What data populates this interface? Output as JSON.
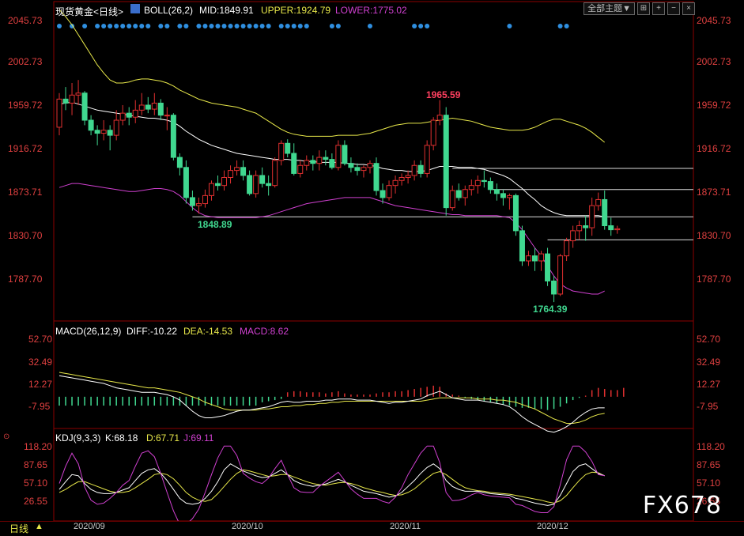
{
  "header": {
    "instrument": "现货黄金<日线>",
    "boll_label": "BOLL(26,2)",
    "mid": "MID:1849.91",
    "upper": "UPPER:1924.79",
    "lower": "LOWER:1775.02",
    "theme_button": "全部主题▼"
  },
  "macd_header": {
    "label": "MACD(26,12,9)",
    "diff": "DIFF:-10.22",
    "dea": "DEA:-14.53",
    "macd": "MACD:8.62"
  },
  "kdj_header": {
    "label": "KDJ(9,3,3)",
    "k": "K:68.18",
    "d": "D:67.71",
    "j": "J:69.11"
  },
  "timeframe": "日线",
  "watermark": "FX678",
  "dates": [
    "2020/09",
    "2020/10",
    "2020/11",
    "2020/12"
  ],
  "price_ticks": [
    "2045.73",
    "2002.73",
    "1959.72",
    "1916.72",
    "1873.71",
    "1830.70",
    "1787.70"
  ],
  "macd_ticks": [
    "52.70",
    "32.49",
    "12.27",
    "-7.95"
  ],
  "kdj_ticks": [
    "118.20",
    "87.65",
    "57.10",
    "26.55"
  ],
  "annotations": {
    "high": "1965.59",
    "low": "1764.39",
    "mark": "1848.89"
  },
  "colors": {
    "up": "#e03030",
    "down": "#40d890",
    "mid": "#ffffff",
    "upper": "#e8e84a",
    "lower": "#d040d0",
    "axis": "#e04040",
    "grid": "#8b0000"
  },
  "chart_data": {
    "type": "candlestick",
    "ylim": [
      1760,
      2050
    ],
    "candles": [
      [
        1938,
        1972,
        1930,
        1966
      ],
      [
        1966,
        1978,
        1955,
        1962
      ],
      [
        1962,
        1982,
        1950,
        1970
      ],
      [
        1970,
        1985,
        1960,
        1972
      ],
      [
        1972,
        1974,
        1940,
        1945
      ],
      [
        1945,
        1950,
        1930,
        1935
      ],
      [
        1935,
        1940,
        1920,
        1932
      ],
      [
        1932,
        1945,
        1925,
        1935
      ],
      [
        1935,
        1940,
        1915,
        1930
      ],
      [
        1930,
        1955,
        1925,
        1945
      ],
      [
        1945,
        1960,
        1940,
        1952
      ],
      [
        1952,
        1958,
        1940,
        1948
      ],
      [
        1948,
        1965,
        1942,
        1955
      ],
      [
        1955,
        1972,
        1950,
        1960
      ],
      [
        1960,
        1968,
        1952,
        1956
      ],
      [
        1956,
        1972,
        1950,
        1962
      ],
      [
        1962,
        1966,
        1945,
        1950
      ],
      [
        1950,
        1958,
        1935,
        1950
      ],
      [
        1950,
        1952,
        1905,
        1908
      ],
      [
        1908,
        1912,
        1890,
        1898
      ],
      [
        1898,
        1905,
        1862,
        1868
      ],
      [
        1868,
        1875,
        1855,
        1860
      ],
      [
        1860,
        1868,
        1852,
        1862
      ],
      [
        1862,
        1876,
        1858,
        1870
      ],
      [
        1870,
        1885,
        1865,
        1882
      ],
      [
        1882,
        1890,
        1875,
        1880
      ],
      [
        1880,
        1895,
        1875,
        1888
      ],
      [
        1888,
        1900,
        1882,
        1895
      ],
      [
        1895,
        1905,
        1890,
        1898
      ],
      [
        1898,
        1905,
        1885,
        1890
      ],
      [
        1890,
        1895,
        1870,
        1872
      ],
      [
        1872,
        1895,
        1868,
        1890
      ],
      [
        1890,
        1898,
        1878,
        1882
      ],
      [
        1882,
        1890,
        1870,
        1880
      ],
      [
        1880,
        1908,
        1878,
        1905
      ],
      [
        1905,
        1925,
        1900,
        1922
      ],
      [
        1922,
        1926,
        1908,
        1912
      ],
      [
        1912,
        1922,
        1890,
        1892
      ],
      [
        1892,
        1905,
        1888,
        1900
      ],
      [
        1900,
        1910,
        1895,
        1905
      ],
      [
        1905,
        1910,
        1895,
        1902
      ],
      [
        1902,
        1915,
        1895,
        1908
      ],
      [
        1908,
        1915,
        1900,
        1906
      ],
      [
        1906,
        1912,
        1896,
        1898
      ],
      [
        1898,
        1925,
        1895,
        1920
      ],
      [
        1920,
        1925,
        1900,
        1902
      ],
      [
        1902,
        1908,
        1893,
        1898
      ],
      [
        1898,
        1902,
        1890,
        1895
      ],
      [
        1895,
        1900,
        1888,
        1898
      ],
      [
        1898,
        1905,
        1892,
        1902
      ],
      [
        1902,
        1908,
        1870,
        1875
      ],
      [
        1875,
        1882,
        1862,
        1868
      ],
      [
        1868,
        1885,
        1865,
        1880
      ],
      [
        1880,
        1890,
        1872,
        1885
      ],
      [
        1885,
        1892,
        1880,
        1888
      ],
      [
        1888,
        1895,
        1882,
        1890
      ],
      [
        1890,
        1905,
        1885,
        1900
      ],
      [
        1900,
        1905,
        1888,
        1892
      ],
      [
        1892,
        1925,
        1888,
        1920
      ],
      [
        1920,
        1948,
        1915,
        1945
      ],
      [
        1945,
        1965,
        1940,
        1950
      ],
      [
        1950,
        1958,
        1850,
        1858
      ],
      [
        1858,
        1880,
        1855,
        1875
      ],
      [
        1875,
        1882,
        1865,
        1868
      ],
      [
        1868,
        1880,
        1860,
        1876
      ],
      [
        1876,
        1886,
        1870,
        1880
      ],
      [
        1880,
        1890,
        1872,
        1885
      ],
      [
        1885,
        1895,
        1878,
        1884
      ],
      [
        1884,
        1888,
        1872,
        1876
      ],
      [
        1876,
        1882,
        1865,
        1872
      ],
      [
        1872,
        1876,
        1860,
        1868
      ],
      [
        1868,
        1872,
        1856,
        1870
      ],
      [
        1870,
        1872,
        1830,
        1835
      ],
      [
        1835,
        1840,
        1800,
        1805
      ],
      [
        1805,
        1815,
        1800,
        1810
      ],
      [
        1810,
        1818,
        1795,
        1805
      ],
      [
        1805,
        1815,
        1795,
        1812
      ],
      [
        1812,
        1818,
        1780,
        1785
      ],
      [
        1785,
        1790,
        1764,
        1772
      ],
      [
        1772,
        1812,
        1770,
        1810
      ],
      [
        1810,
        1828,
        1805,
        1825
      ],
      [
        1825,
        1840,
        1818,
        1835
      ],
      [
        1835,
        1845,
        1826,
        1840
      ],
      [
        1840,
        1850,
        1825,
        1838
      ],
      [
        1838,
        1868,
        1830,
        1860
      ],
      [
        1860,
        1873,
        1855,
        1866
      ],
      [
        1866,
        1875,
        1836,
        1840
      ],
      [
        1840,
        1848,
        1830,
        1836
      ],
      [
        1836,
        1840,
        1832,
        1837
      ]
    ],
    "mid_line": [
      1961,
      1962,
      1963,
      1961,
      1959,
      1957,
      1955,
      1954,
      1953,
      1952,
      1951,
      1950,
      1949,
      1948,
      1947,
      1947,
      1946,
      1945,
      1943,
      1939,
      1934,
      1930,
      1926,
      1923,
      1920,
      1918,
      1916,
      1914,
      1912,
      1911,
      1910,
      1909,
      1908,
      1907,
      1906,
      1906,
      1906,
      1905,
      1905,
      1904,
      1904,
      1903,
      1903,
      1903,
      1903,
      1902,
      1902,
      1901,
      1901,
      1900,
      1899,
      1897,
      1896,
      1895,
      1895,
      1894,
      1894,
      1894,
      1895,
      1897,
      1899,
      1899,
      1899,
      1898,
      1898,
      1898,
      1897,
      1896,
      1894,
      1892,
      1890,
      1887,
      1882,
      1877,
      1871,
      1866,
      1860,
      1856,
      1853,
      1851,
      1850,
      1850,
      1850,
      1850,
      1850,
      1850,
      1849
    ],
    "upper_line": [
      2055,
      2048,
      2040,
      2030,
      2020,
      2010,
      2000,
      1992,
      1985,
      1982,
      1982,
      1983,
      1985,
      1986,
      1986,
      1985,
      1984,
      1982,
      1979,
      1975,
      1972,
      1969,
      1966,
      1964,
      1962,
      1961,
      1960,
      1959,
      1958,
      1956,
      1954,
      1952,
      1948,
      1944,
      1940,
      1936,
      1933,
      1931,
      1930,
      1929,
      1929,
      1929,
      1929,
      1929,
      1930,
      1930,
      1930,
      1930,
      1931,
      1932,
      1934,
      1936,
      1938,
      1940,
      1941,
      1942,
      1942,
      1942,
      1943,
      1944,
      1945,
      1946,
      1947,
      1946,
      1945,
      1944,
      1942,
      1940,
      1938,
      1937,
      1936,
      1935,
      1935,
      1935,
      1936,
      1938,
      1941,
      1944,
      1946,
      1946,
      1944,
      1942,
      1940,
      1937,
      1933,
      1928,
      1923
    ],
    "lower_line": [
      1878,
      1880,
      1882,
      1882,
      1881,
      1880,
      1879,
      1878,
      1877,
      1876,
      1875,
      1874,
      1874,
      1875,
      1876,
      1877,
      1877,
      1876,
      1874,
      1870,
      1864,
      1858,
      1853,
      1850,
      1849,
      1848,
      1848,
      1848,
      1848,
      1848,
      1848,
      1848,
      1849,
      1850,
      1852,
      1854,
      1856,
      1858,
      1860,
      1862,
      1863,
      1864,
      1865,
      1866,
      1867,
      1868,
      1868,
      1868,
      1868,
      1868,
      1866,
      1864,
      1862,
      1860,
      1859,
      1858,
      1857,
      1856,
      1855,
      1854,
      1853,
      1852,
      1851,
      1851,
      1850,
      1850,
      1850,
      1850,
      1850,
      1850,
      1849,
      1848,
      1843,
      1836,
      1827,
      1818,
      1810,
      1800,
      1790,
      1782,
      1778,
      1775,
      1774,
      1773,
      1772,
      1772,
      1775
    ],
    "macd_hist": [
      -8,
      -8,
      -8,
      -8,
      -8,
      -8,
      -8,
      -8,
      -8,
      -8,
      -8,
      -8,
      -8,
      -8,
      -8,
      -8,
      -8,
      -8,
      -8,
      -8,
      -8,
      -8,
      -8,
      -8,
      -8,
      -8,
      -8,
      -8,
      -8,
      -8,
      -8,
      -8,
      -5,
      -4,
      -3,
      -2,
      4,
      5,
      5,
      4,
      4,
      4,
      3,
      4,
      5,
      3,
      2,
      2,
      2,
      2,
      3,
      4,
      4,
      5,
      5,
      6,
      7,
      8,
      9,
      10,
      9,
      3,
      2,
      1,
      -1,
      -2,
      -3,
      -4,
      -5,
      -6,
      -7,
      -8,
      -9,
      -10,
      -10,
      -11,
      -11,
      -12,
      -11,
      -9,
      -6,
      -3,
      -1,
      1,
      6,
      8,
      7,
      6,
      6,
      8
    ],
    "macd_diff": [
      19,
      18,
      17,
      16,
      15,
      14,
      13,
      12,
      10,
      8,
      7,
      6,
      5,
      4,
      4,
      4,
      3,
      2,
      0,
      -3,
      -8,
      -13,
      -17,
      -19,
      -19,
      -18,
      -17,
      -15,
      -13,
      -12,
      -12,
      -11,
      -10,
      -9,
      -7,
      -5,
      -4,
      -5,
      -5,
      -4,
      -4,
      -4,
      -3,
      -3,
      -2,
      -2,
      -2,
      -3,
      -3,
      -3,
      -4,
      -5,
      -6,
      -5,
      -5,
      -4,
      -3,
      -2,
      1,
      3,
      5,
      2,
      -1,
      -2,
      -3,
      -3,
      -3,
      -4,
      -5,
      -6,
      -7,
      -9,
      -13,
      -18,
      -22,
      -25,
      -28,
      -31,
      -32,
      -30,
      -27,
      -23,
      -18,
      -14,
      -11,
      -10,
      -10
    ],
    "macd_dea": [
      22,
      21,
      20,
      19,
      18,
      17,
      16,
      15,
      14,
      13,
      12,
      11,
      10,
      9,
      8,
      8,
      7,
      6,
      5,
      4,
      2,
      0,
      -2,
      -5,
      -7,
      -9,
      -11,
      -12,
      -12,
      -12,
      -12,
      -12,
      -11,
      -11,
      -10,
      -9,
      -9,
      -8,
      -8,
      -7,
      -7,
      -6,
      -6,
      -5,
      -5,
      -4,
      -4,
      -4,
      -4,
      -4,
      -4,
      -4,
      -4,
      -4,
      -4,
      -4,
      -4,
      -4,
      -3,
      -2,
      -1,
      -1,
      -1,
      -1,
      -1,
      -1,
      -2,
      -2,
      -2,
      -3,
      -3,
      -4,
      -5,
      -7,
      -9,
      -11,
      -14,
      -17,
      -20,
      -22,
      -24,
      -24,
      -23,
      -21,
      -18,
      -16,
      -15
    ],
    "kdj_k": [
      45,
      58,
      70,
      68,
      55,
      45,
      40,
      38,
      38,
      40,
      44,
      48,
      60,
      72,
      78,
      80,
      72,
      60,
      45,
      30,
      22,
      20,
      22,
      30,
      42,
      58,
      78,
      88,
      82,
      76,
      72,
      68,
      65,
      66,
      72,
      78,
      70,
      60,
      55,
      52,
      50,
      52,
      54,
      58,
      62,
      58,
      52,
      47,
      42,
      40,
      38,
      35,
      32,
      34,
      40,
      50,
      60,
      72,
      82,
      88,
      80,
      60,
      50,
      45,
      42,
      42,
      42,
      40,
      38,
      37,
      36,
      35,
      30,
      28,
      25,
      22,
      20,
      18,
      20,
      35,
      55,
      75,
      85,
      88,
      80,
      72,
      68
    ],
    "kdj_d": [
      40,
      45,
      52,
      58,
      58,
      54,
      50,
      46,
      42,
      40,
      40,
      42,
      48,
      55,
      62,
      70,
      72,
      70,
      63,
      52,
      40,
      32,
      27,
      25,
      28,
      38,
      50,
      62,
      72,
      78,
      76,
      73,
      70,
      67,
      68,
      70,
      70,
      66,
      62,
      58,
      55,
      53,
      52,
      54,
      56,
      57,
      55,
      52,
      48,
      45,
      42,
      40,
      37,
      35,
      36,
      40,
      46,
      55,
      64,
      72,
      75,
      70,
      62,
      54,
      48,
      45,
      43,
      42,
      40,
      39,
      38,
      37,
      35,
      33,
      31,
      29,
      27,
      24,
      22,
      26,
      35,
      48,
      60,
      70,
      74,
      73,
      68
    ],
    "kdj_j": [
      55,
      84,
      106,
      88,
      49,
      27,
      20,
      22,
      30,
      40,
      52,
      60,
      84,
      106,
      110,
      100,
      72,
      40,
      9,
      -14,
      -14,
      -4,
      12,
      40,
      70,
      98,
      118,
      118,
      102,
      72,
      64,
      58,
      55,
      64,
      80,
      94,
      70,
      48,
      41,
      40,
      40,
      50,
      58,
      66,
      74,
      60,
      46,
      37,
      30,
      30,
      30,
      25,
      22,
      32,
      48,
      70,
      88,
      106,
      118,
      118,
      90,
      40,
      26,
      27,
      30,
      36,
      40,
      36,
      34,
      33,
      32,
      31,
      20,
      18,
      13,
      8,
      6,
      6,
      16,
      53,
      95,
      118,
      118,
      108,
      92,
      70,
      68
    ]
  }
}
